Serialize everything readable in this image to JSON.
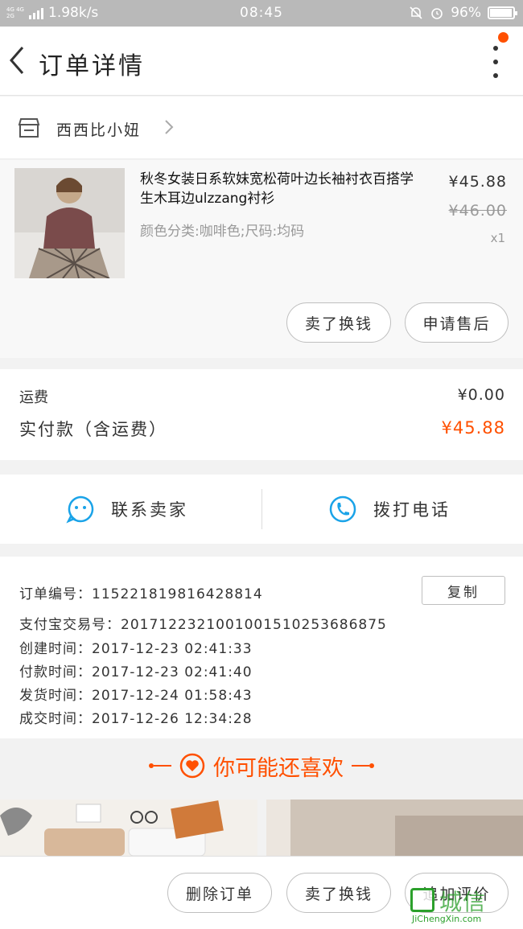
{
  "status_bar": {
    "network": "4G 4G 2G",
    "speed": "1.98k/s",
    "time": "08:45",
    "battery": "96%",
    "battery_level": 0.96
  },
  "nav": {
    "title": "订单详情"
  },
  "shop": {
    "name": "西西比小妞"
  },
  "product": {
    "title": "秋冬女装日系软妹宽松荷叶边长袖衬衣百搭学生木耳边ulzzang衬衫",
    "spec": "颜色分类:咖啡色;尺码:均码",
    "price": "¥45.88",
    "original_price": "¥46.00",
    "quantity": "x1",
    "btn_refund": "卖了换钱",
    "btn_aftersale": "申请售后"
  },
  "fee": {
    "shipping_label": "运费",
    "shipping_value": "¥0.00",
    "paid_label": "实付款（含运费）",
    "paid_value": "¥45.88"
  },
  "contact": {
    "seller": "联系卖家",
    "call": "拨打电话"
  },
  "order_info": {
    "order_no": "订单编号：115221819816428814",
    "copy": "复制",
    "alipay_no": "支付宝交易号：2017122321001001510253686875",
    "created": "创建时间：2017-12-23 02:41:33",
    "paid": "付款时间：2017-12-23 02:41:40",
    "shipped": "发货时间：2017-12-24 01:58:43",
    "completed": "成交时间：2017-12-26 12:34:28"
  },
  "recommend": {
    "title": "你可能还喜欢"
  },
  "bottom": {
    "delete": "删除订单",
    "sell": "卖了换钱",
    "review": "追加评价"
  },
  "watermark": {
    "cn": "城信",
    "en": "JiChengXin.com"
  },
  "colors": {
    "accent": "#ff5000",
    "icon_blue": "#1aa3e8"
  }
}
